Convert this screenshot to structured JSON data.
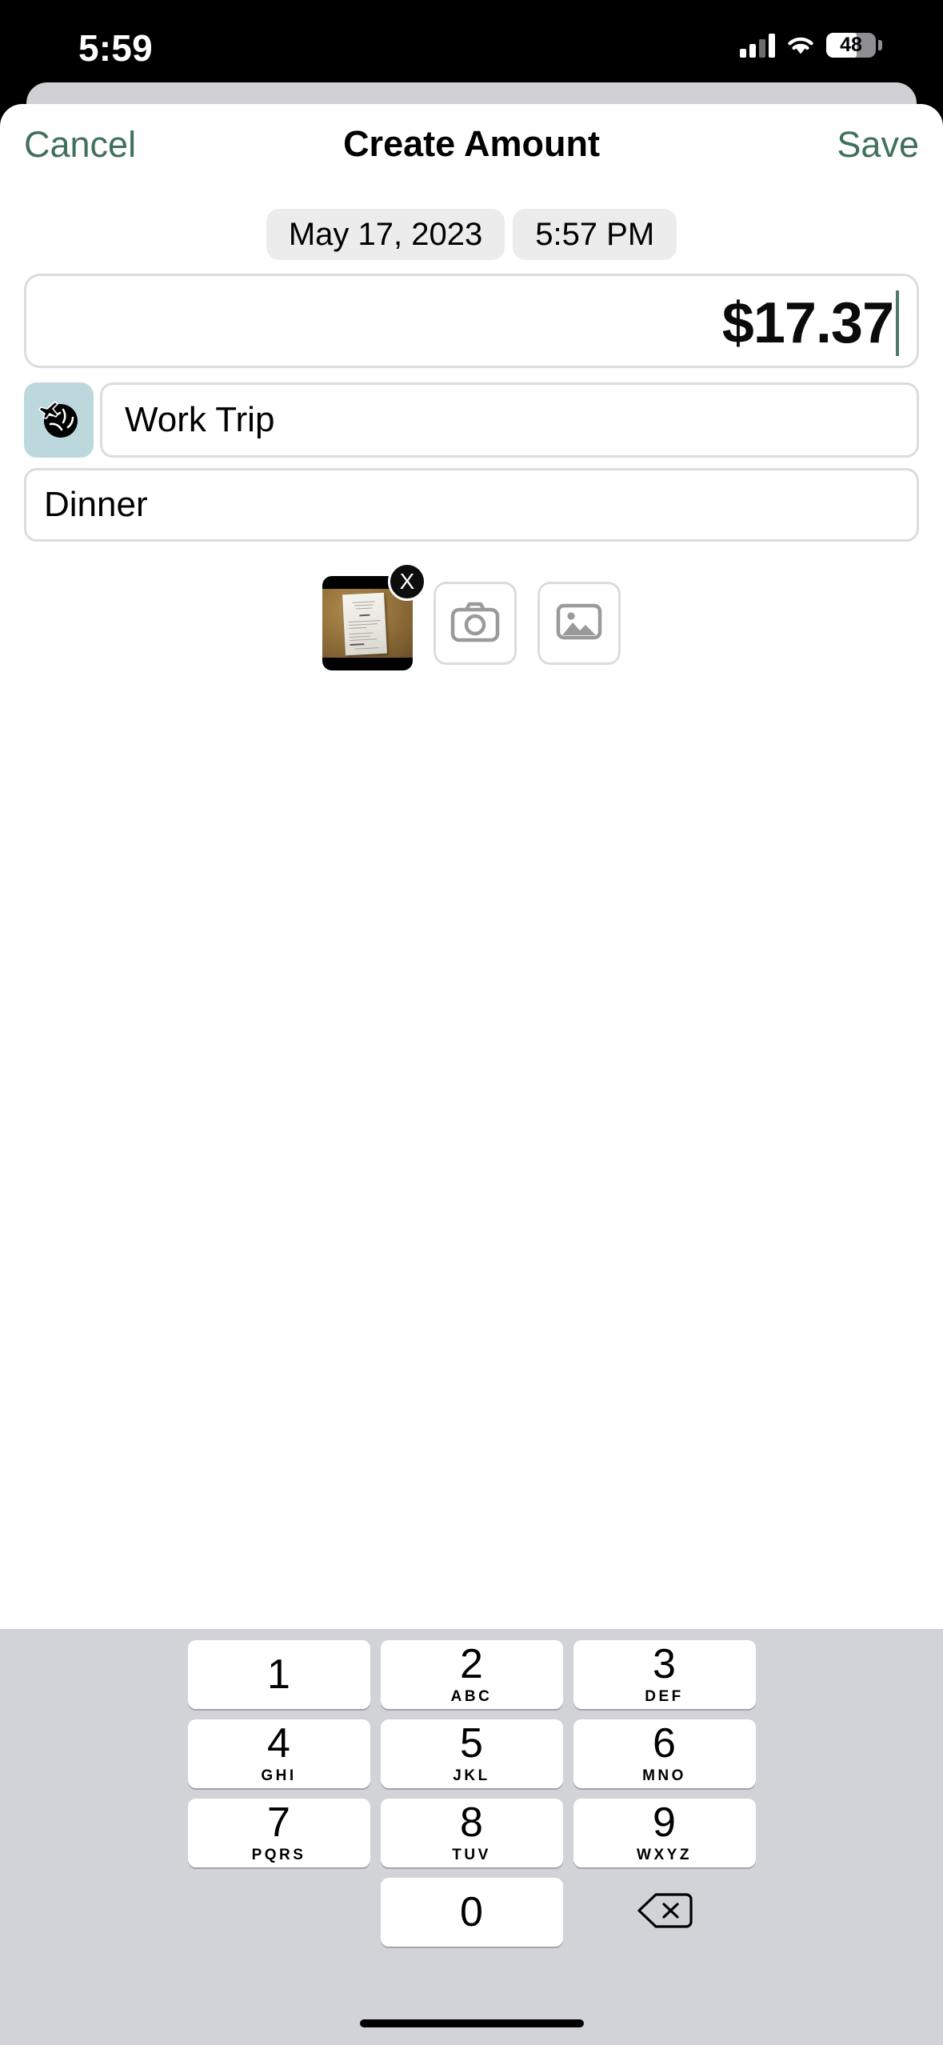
{
  "status_bar": {
    "time": "5:59",
    "battery_percent": "48",
    "cellular_icon": "cellular-bars-icon",
    "wifi_icon": "wifi-icon",
    "battery_icon": "battery-icon"
  },
  "header": {
    "cancel_label": "Cancel",
    "title": "Create Amount",
    "save_label": "Save",
    "accent_color": "#40705a"
  },
  "form": {
    "date_value": "May 17, 2023",
    "time_value": "5:57 PM",
    "amount_value": "$17.37",
    "category_icon": "globe-airplane-icon",
    "category_icon_glyph": "🌍",
    "category_value": "Work Trip",
    "category_placeholder": "Category",
    "note_value": "Dinner",
    "note_placeholder": "Note",
    "attachment_delete_label": "X",
    "camera_button_icon": "camera-icon",
    "photo_library_button_icon": "photo-library-icon"
  },
  "keypad": {
    "rows": [
      [
        {
          "num": "1",
          "letters": ""
        },
        {
          "num": "2",
          "letters": "ABC"
        },
        {
          "num": "3",
          "letters": "DEF"
        }
      ],
      [
        {
          "num": "4",
          "letters": "GHI"
        },
        {
          "num": "5",
          "letters": "JKL"
        },
        {
          "num": "6",
          "letters": "MNO"
        }
      ],
      [
        {
          "num": "7",
          "letters": "PQRS"
        },
        {
          "num": "8",
          "letters": "TUV"
        },
        {
          "num": "9",
          "letters": "WXYZ"
        }
      ],
      [
        {
          "num": "",
          "letters": ""
        },
        {
          "num": "0",
          "letters": ""
        },
        {
          "num": "delete-icon",
          "letters": ""
        }
      ]
    ],
    "background_color": "#d1d3d9",
    "key_color": "#ffffff"
  }
}
